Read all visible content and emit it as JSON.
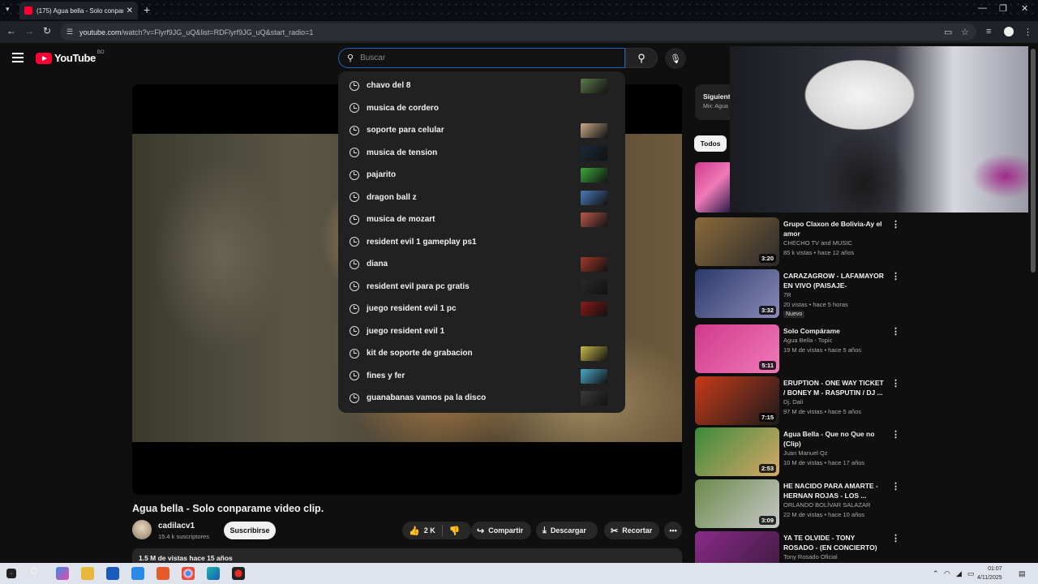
{
  "browser": {
    "tab_title": "(175) Agua bella - Solo conpara",
    "url_host": "youtube.com",
    "url_path": "/watch?v=Flyrf9JG_uQ&list=RDFlyrf9JG_uQ&start_radio=1"
  },
  "header": {
    "logo_text": "YouTube",
    "country_code": "BO",
    "search_placeholder": "Buscar"
  },
  "suggestions": [
    {
      "text": "chavo del 8",
      "has_thumb": true,
      "thumb_color": "#5a7a4a"
    },
    {
      "text": "musica de cordero",
      "has_thumb": false
    },
    {
      "text": "soporte para celular",
      "has_thumb": true,
      "thumb_color": "#c9a98a"
    },
    {
      "text": "musica de tension",
      "has_thumb": true,
      "thumb_color": "#1c2a3a"
    },
    {
      "text": "pajarito",
      "has_thumb": true,
      "thumb_color": "#3aa83a"
    },
    {
      "text": "dragon ball z",
      "has_thumb": true,
      "thumb_color": "#4a7ab8"
    },
    {
      "text": "musica de mozart",
      "has_thumb": true,
      "thumb_color": "#b85a4a"
    },
    {
      "text": "resident evil 1 gameplay ps1",
      "has_thumb": false
    },
    {
      "text": "diana",
      "has_thumb": true,
      "thumb_color": "#a03a2a"
    },
    {
      "text": "resident evil para pc gratis",
      "has_thumb": true,
      "thumb_color": "#2a2a2a"
    },
    {
      "text": "juego resident evil 1 pc",
      "has_thumb": true,
      "thumb_color": "#8a1a1a"
    },
    {
      "text": "juego resident evil 1",
      "has_thumb": false
    },
    {
      "text": "kit de soporte de grabacion",
      "has_thumb": true,
      "thumb_color": "#c9b84a"
    },
    {
      "text": "fines y fer",
      "has_thumb": true,
      "thumb_color": "#4aa8c8"
    },
    {
      "text": "guanabanas vamos pa la disco",
      "has_thumb": true,
      "thumb_color": "#3a3a3a"
    }
  ],
  "video": {
    "title": "Agua bella - Solo conparame video clip.",
    "channel": "cadilacv1",
    "subscribers": "15.4 k suscriptores",
    "subscribe_label": "Suscribirse",
    "likes": "2 K",
    "share_label": "Compartir",
    "download_label": "Descargar",
    "clip_label": "Recortar",
    "views_line": "1.5 M de vistas  hace 15 años"
  },
  "sidebar": {
    "queue_title": "Siguiente",
    "queue_sub": "Mix: Agua",
    "chip_label": "Todos",
    "recommendations": [
      {
        "title": "Grupo Claxon de Bolivia-Ay el amor",
        "channel": "CHECHO TV and MUSIC",
        "meta": "85 k vistas • hace 12 años",
        "duration": "3:20",
        "colors": [
          "#8a6a3a",
          "#2a2a2a"
        ]
      },
      {
        "title": "CARAZAGROW - LAFAMAYOR EN VIVO (PAISAJE-TUCARCEL)",
        "channel": "7R",
        "meta": "20 vistas • hace 5 horas",
        "duration": "3:32",
        "badge": "Nuevo",
        "colors": [
          "#2a3a6a",
          "#8a8ab8"
        ]
      },
      {
        "title": "Solo Compárame",
        "channel": "Agua Bella - Topic",
        "meta": "19 M de vistas • hace 5 años",
        "duration": "5:11",
        "colors": [
          "#d03a8c",
          "#f07ab8"
        ]
      },
      {
        "title": "ERUPTION - ONE WAY TICKET / BONEY M - RASPUTIN / DJ ...",
        "channel": "Dj. Dali",
        "meta": "97 M de vistas • hace 5 años",
        "duration": "7:15",
        "colors": [
          "#c83a1a",
          "#1a1a1a"
        ]
      },
      {
        "title": "Agua Bella - Que no Que no (Clip)",
        "channel": "Juan Manuel Qz",
        "meta": "10 M de vistas • hace 17 años",
        "duration": "2:53",
        "colors": [
          "#3a8a3a",
          "#d8a86a"
        ]
      },
      {
        "title": "HE NACIDO PARA AMARTE - HERNAN ROJAS -   LOS ...",
        "channel": "ORLANDO BOLÍVAR SALAZAR",
        "meta": "22 M de vistas • hace 10 años",
        "duration": "3:09",
        "colors": [
          "#6a8a4a",
          "#c8c8c8"
        ]
      },
      {
        "title": "YA TE OLVIDE - TONY ROSADO - (EN CONCIERTO)",
        "channel": "Tony Rosado Oficial",
        "meta": "",
        "duration": "",
        "colors": [
          "#8a2a8a",
          "#3a1a3a"
        ]
      }
    ]
  },
  "taskbar": {
    "time": "01:07",
    "date": "4/11/2025"
  }
}
